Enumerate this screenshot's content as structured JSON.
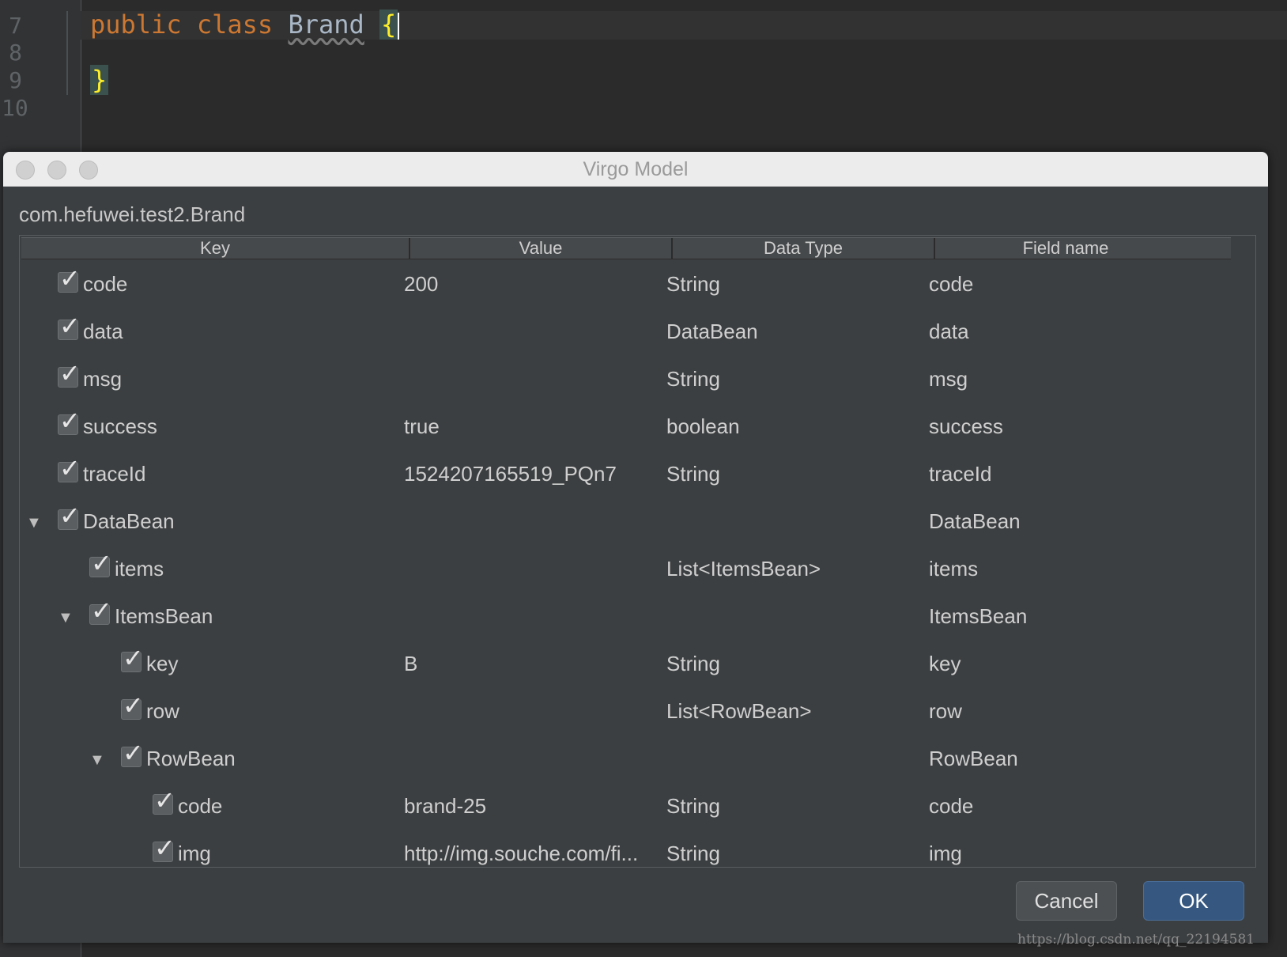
{
  "editor": {
    "line_numbers": [
      "7",
      "8",
      "9",
      "10"
    ],
    "code": {
      "kw_public": "public",
      "kw_class": "class",
      "class_name": "Brand",
      "open_brace": "{",
      "close_brace": "}"
    }
  },
  "dialog": {
    "title": "Virgo Model",
    "class_path": "com.hefuwei.test2.Brand",
    "columns": [
      "Key",
      "Value",
      "Data Type",
      "Field name"
    ],
    "rows": [
      {
        "key": "code",
        "value": "200",
        "type": "String",
        "field": "code",
        "checked": true,
        "expander": ""
      },
      {
        "key": "data",
        "value": "",
        "type": "DataBean",
        "field": "data",
        "checked": true,
        "expander": ""
      },
      {
        "key": "msg",
        "value": "",
        "type": "String",
        "field": "msg",
        "checked": true,
        "expander": ""
      },
      {
        "key": "success",
        "value": "true",
        "type": "boolean",
        "field": "success",
        "checked": true,
        "expander": ""
      },
      {
        "key": "traceId",
        "value": "1524207165519_PQn7",
        "type": "String",
        "field": "traceId",
        "checked": true,
        "expander": ""
      },
      {
        "key": "DataBean",
        "value": "",
        "type": "",
        "field": "DataBean",
        "checked": true,
        "expander": "▼"
      },
      {
        "key": "items",
        "value": "",
        "type": "List<ItemsBean>",
        "field": "items",
        "checked": true,
        "expander": ""
      },
      {
        "key": "ItemsBean",
        "value": "",
        "type": "",
        "field": "ItemsBean",
        "checked": true,
        "expander": "▼"
      },
      {
        "key": "key",
        "value": "B",
        "type": "String",
        "field": "key",
        "checked": true,
        "expander": ""
      },
      {
        "key": "row",
        "value": "",
        "type": "List<RowBean>",
        "field": "row",
        "checked": true,
        "expander": ""
      },
      {
        "key": "RowBean",
        "value": "",
        "type": "",
        "field": "RowBean",
        "checked": true,
        "expander": "▼"
      },
      {
        "key": "code",
        "value": "brand-25",
        "type": "String",
        "field": "code",
        "checked": true,
        "expander": ""
      },
      {
        "key": "img",
        "value": "http://img.souche.com/fi...",
        "type": "String",
        "field": "img",
        "checked": true,
        "expander": ""
      }
    ],
    "checkmark": "✓",
    "buttons": {
      "cancel": "Cancel",
      "ok": "OK"
    }
  },
  "watermark": "https://blog.csdn.net/qq_22194581",
  "colors": {
    "editor_bg": "#2b2b2b",
    "keyword": "#cc7832",
    "brace": "#ffef28",
    "dialog_bg": "#3c3f41",
    "ok_button": "#365880"
  }
}
